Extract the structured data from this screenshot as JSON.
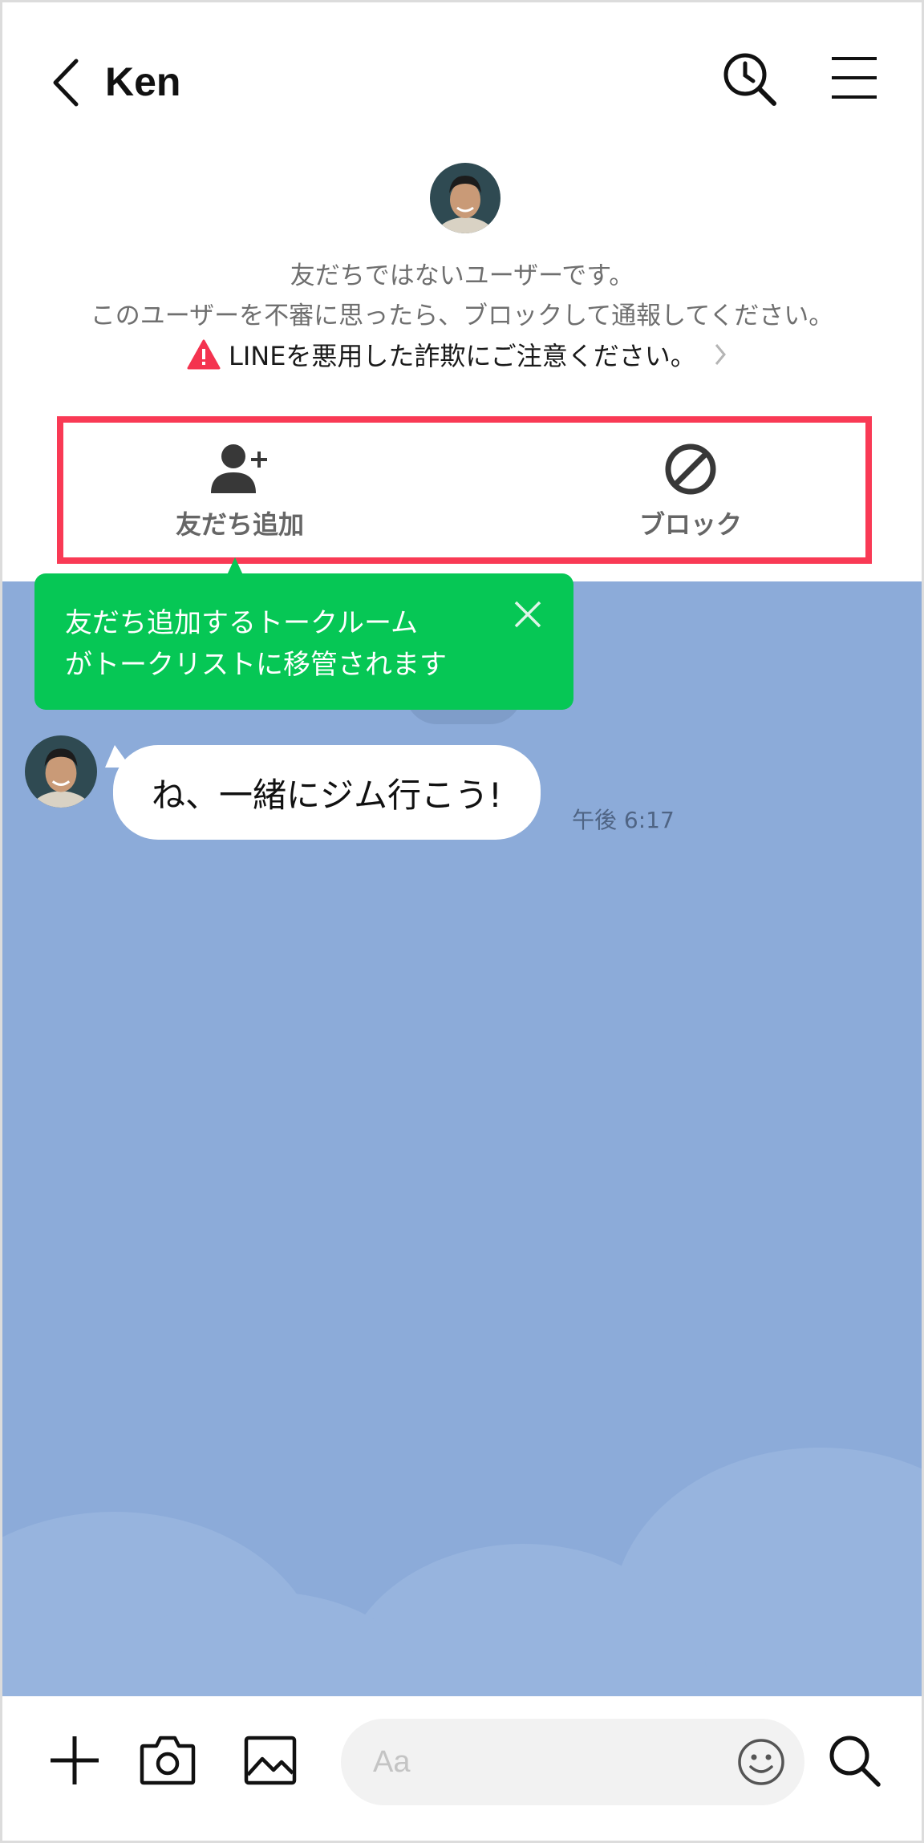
{
  "header": {
    "title": "Ken"
  },
  "profile": {
    "notice_line1": "友だちではないユーザーです。",
    "notice_line2": "このユーザーを不審に思ったら、ブロックして通報してください。",
    "warning": "LINEを悪用した詐欺にご注意ください。"
  },
  "actions": {
    "add_friend_label": "友だち追加",
    "block_label": "ブロック"
  },
  "tooltip": {
    "line1": "友だち追加するトークルーム",
    "line2": "がトークリストに移管されます"
  },
  "message": {
    "text": "ね、一緒にジム行こう!",
    "time": "午後 6:17"
  },
  "input": {
    "placeholder": "Aa"
  },
  "colors": {
    "chat_background": "#8cabd9",
    "highlight_border": "#f93a55",
    "tooltip": "#06c755",
    "warning_icon": "#f4334f"
  },
  "icons": {
    "back": "chevron-left-icon",
    "history": "clock-search-icon",
    "menu": "hamburger-menu-icon",
    "warning": "warning-triangle-icon",
    "add_friend": "add-user-icon",
    "block": "block-icon",
    "close": "close-icon",
    "plus": "plus-icon",
    "camera": "camera-icon",
    "image": "image-icon",
    "emoji": "emoji-icon",
    "search": "search-icon"
  }
}
